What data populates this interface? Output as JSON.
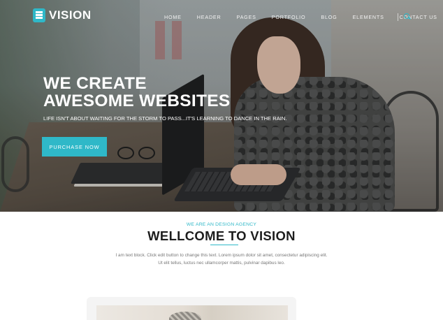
{
  "header": {
    "logo_text": "VISION",
    "nav": [
      "HOME",
      "HEADER",
      "PAGES",
      "PORTFOLIO",
      "BLOG",
      "ELEMENTS",
      "CONTACT US"
    ]
  },
  "hero": {
    "title": "WE CREATE\nAWESOME WEBSITES",
    "subtitle": "LIFE ISN'T ABOUT WAITING FOR THE STORM TO PASS...IT'S LEARNING TO DANCE IN THE RAIN.",
    "cta_label": "PURCHASE NOW"
  },
  "intro": {
    "kicker": "WE ARE AN DESIGN AGENCY",
    "title": "WELLCOME TO VISION",
    "text_line1": "I am text block. Click edit button to change this text. Lorem ipsum dolor sit amet, consectetur adipiscing elit.",
    "text_line2": "Ut elit tellus, luctus nec ullamcorper mattis, pulvinar dapibus leo."
  },
  "colors": {
    "accent": "#2fb8c8",
    "heading": "#1d1d1d",
    "body_text": "#777777"
  },
  "icons": [
    "logo-icon",
    "search-icon"
  ]
}
